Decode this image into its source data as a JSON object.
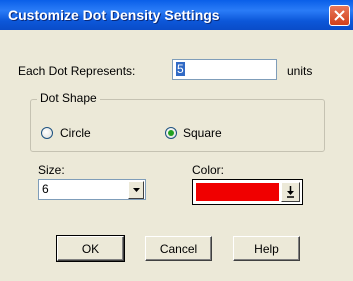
{
  "window": {
    "title": "Customize Dot Density Settings"
  },
  "dot_value": {
    "label": "Each Dot Represents:",
    "value": "5",
    "unit": "units"
  },
  "dot_shape": {
    "legend": "Dot Shape",
    "options": [
      {
        "label": "Circle",
        "selected": false
      },
      {
        "label": "Square",
        "selected": true
      }
    ]
  },
  "size": {
    "label": "Size:",
    "value": "6"
  },
  "color": {
    "label": "Color:",
    "value": "#f00000"
  },
  "buttons": {
    "ok": "OK",
    "cancel": "Cancel",
    "help": "Help"
  }
}
